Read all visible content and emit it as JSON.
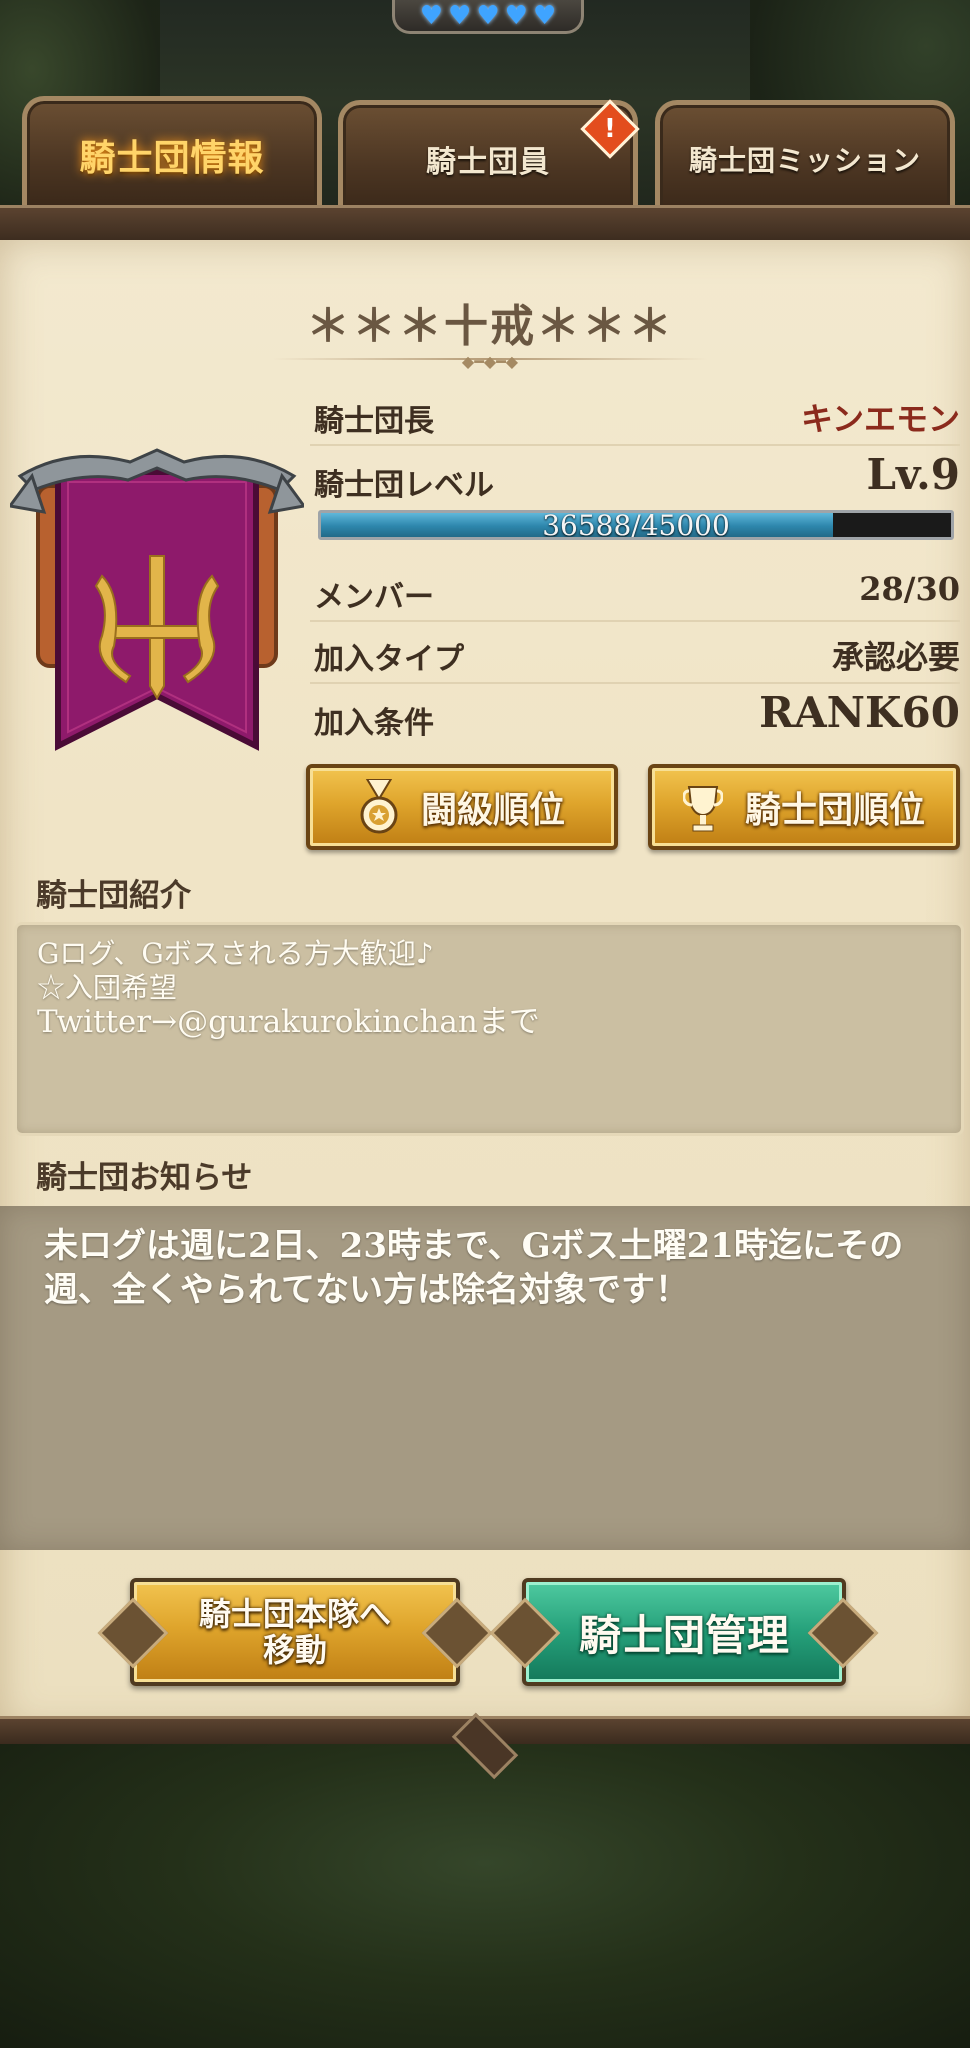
{
  "status": {
    "hearts": 5
  },
  "tabs": [
    {
      "label": "騎士団情報",
      "active": true
    },
    {
      "label": "騎士団員",
      "active": false,
      "alert": "!"
    },
    {
      "label": "騎士団ミッション",
      "active": false
    }
  ],
  "guild": {
    "name": "＊＊＊十戒＊＊＊",
    "leader_label": "騎士団長",
    "leader": "キンエモン",
    "level_label": "騎士団レベル",
    "level": "Lv.9",
    "exp_text": "36588/45000",
    "exp_current": 36588,
    "exp_max": 45000,
    "members_label": "メンバー",
    "members": "28/30",
    "join_type_label": "加入タイプ",
    "join_type": "承認必要",
    "join_cond_label": "加入条件",
    "join_cond": "RANK60"
  },
  "buttons": {
    "battle_rank": "闘級順位",
    "guild_rank": "騎士団順位",
    "move_main": "騎士団本隊へ移動",
    "move_main_line1": "騎士団本隊へ",
    "move_main_line2": "移動",
    "manage": "騎士団管理"
  },
  "intro": {
    "title": "騎士団紹介",
    "line1": "Gログ、Gボスされる方大歓迎♪",
    "line2": "☆入団希望",
    "line3": "Twitter→@gurakurokinchanまで"
  },
  "notice": {
    "title": "騎士団お知らせ",
    "line1": "未ログは週に2日、23時まで、Gボス土曜21時迄にその",
    "line2": "週、全くやられてない方は除名対象です！"
  },
  "colors": {
    "banner": "#8e1a6b",
    "emblem": "#e2b54a",
    "exp_bar": "#2d86ac",
    "gold_button": "#dfa52c",
    "green_button": "#25a07a"
  }
}
